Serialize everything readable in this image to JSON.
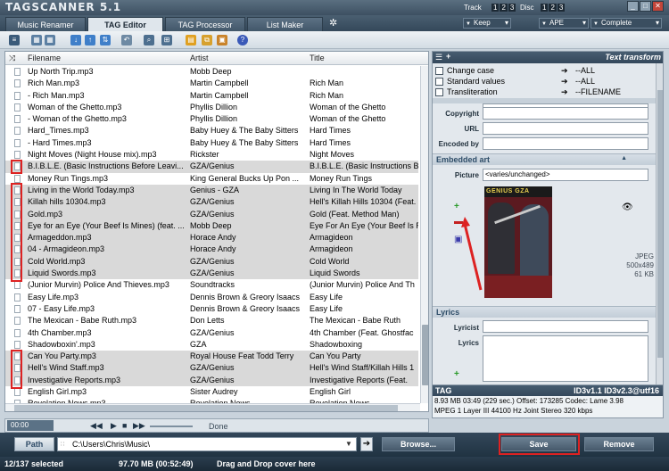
{
  "app": {
    "logo": "TAGSCANNER 5.1"
  },
  "top": {
    "track_label": "Track",
    "track_nums": [
      "1",
      "2",
      "3"
    ],
    "disc_label": "Disc",
    "disc_nums": [
      "1",
      "2",
      "3"
    ],
    "keep": "Keep",
    "ape": "APE",
    "complete": "Complete"
  },
  "tabs": [
    "Music Renamer",
    "TAG Editor",
    "TAG Processor",
    "List Maker"
  ],
  "active_tab": 1,
  "list": {
    "headers": [
      "Filename",
      "Artist",
      "Title"
    ],
    "rows": [
      [
        "Up North Trip.mp3",
        "Mobb Deep",
        ""
      ],
      [
        "Rich Man.mp3",
        "Martin Campbell",
        "Rich Man"
      ],
      [
        "- Rich Man.mp3",
        "Martin Campbell",
        "Rich Man"
      ],
      [
        "Woman of the Ghetto.mp3",
        "Phyllis Dillion",
        "Woman of the Ghetto"
      ],
      [
        "- Woman of the Ghetto.mp3",
        "Phyllis Dillion",
        "Woman of the Ghetto"
      ],
      [
        "Hard_Times.mp3",
        "Baby Huey & The Baby Sitters",
        "Hard Times"
      ],
      [
        "- Hard Times.mp3",
        "Baby Huey & The Baby Sitters",
        "Hard Times"
      ],
      [
        "Night Moves (Night House mix).mp3",
        "Rickster",
        "Night Moves"
      ],
      [
        "B.I.B.L.E. (Basic Instructions Before Leavi...",
        "GZA/Genius",
        "B.I.B.L.E. (Basic Instructions Be"
      ],
      [
        "Money Run Tings.mp3",
        "King General Bucks Up Pon ...",
        "Money Run Tings"
      ],
      [
        "Living in the World Today.mp3",
        "Genius - GZA",
        "Living In The World Today"
      ],
      [
        "Killah hills 10304.mp3",
        "GZA/Genius",
        "Hell's Killah Hills 10304 (Feat."
      ],
      [
        "Gold.mp3",
        "GZA/Genius",
        "Gold (Feat. Method Man)"
      ],
      [
        "Eye for an Eye (Your Beef Is Mines) (feat. ...",
        "Mobb Deep",
        "Eye For An Eye (Your Beef Is Ra"
      ],
      [
        "Armageddon.mp3",
        "Horace Andy",
        "Armagideon"
      ],
      [
        "04 - Armagideon.mp3",
        "Horace Andy",
        "Armagideon"
      ],
      [
        "Cold World.mp3",
        "GZA/Genius",
        "Cold World"
      ],
      [
        "Liquid Swords.mp3",
        "GZA/Genius",
        "Liquid Swords"
      ],
      [
        "(Junior Murvin) Police And Thieves.mp3",
        "Soundtracks",
        "(Junior Murvin) Police And Th"
      ],
      [
        "Easy Life.mp3",
        "Dennis Brown & Greory Isaacs",
        "Easy Life"
      ],
      [
        "07 - Easy Life.mp3",
        "Dennis Brown & Greory Isaacs",
        "Easy Life"
      ],
      [
        "The Mexican - Babe Ruth.mp3",
        "Don Letts",
        "The Mexican - Babe Ruth"
      ],
      [
        "4th Chamber.mp3",
        "GZA/Genius",
        "4th Chamber (Feat. Ghostfac"
      ],
      [
        "Shadowboxin'.mp3",
        "GZA",
        "Shadowboxing"
      ],
      [
        "Can You Party.mp3",
        "Royal House Feat Todd Terry",
        "Can You Party"
      ],
      [
        "Hell's Wind Staff.mp3",
        "GZA/Genius",
        "Hell's Wind Staff/Killah Hills 1"
      ],
      [
        "Investigative Reports.mp3",
        "GZA/Genius",
        "Investigative Reports (Feat."
      ],
      [
        "English Girl.mp3",
        "Sister Audrey",
        "English Girl"
      ],
      [
        "Revelation News.mp3",
        "Revelation News",
        "Revelation News"
      ]
    ],
    "selected": [
      8,
      10,
      11,
      12,
      13,
      14,
      15,
      16,
      17,
      24,
      25,
      26
    ]
  },
  "player": {
    "time": "00:00",
    "status": "Done"
  },
  "transform": {
    "title": "Text transform",
    "items": [
      {
        "label": "Change case",
        "value": "--ALL"
      },
      {
        "label": "Standard values",
        "value": "--ALL"
      },
      {
        "label": "Transliteration",
        "value": "--FILENAME"
      }
    ]
  },
  "fields": {
    "copyright": "Copyright",
    "url": "URL",
    "encoded_by": "Encoded by"
  },
  "art": {
    "section": "Embedded art",
    "picture_label": "Picture",
    "picture_value": "<varies/unchanged>",
    "cover_text": "GENIUS GZA",
    "format": "JPEG",
    "dims": "500x489",
    "size": "61 KB"
  },
  "lyrics": {
    "section": "Lyrics",
    "lyricist": "Lyricist",
    "lyrics": "Lyrics"
  },
  "tag": {
    "label": "TAG",
    "versions": "ID3v1.1   ID3v2.3@utf16",
    "line1": "8.93 MB 03:49 (229 sec.)  Offset: 173285  Codec: Lame 3.98",
    "line2": "MPEG 1 Layer III  44100 Hz  Joint Stereo  320 kbps"
  },
  "path": {
    "label": "Path",
    "value": "C:\\Users\\Chris\\Music\\",
    "browse": "Browse...",
    "save": "Save",
    "remove": "Remove"
  },
  "status": {
    "selected": "12/137 selected",
    "size": "97.70 MB (00:52:49)",
    "hint": "Drag and Drop cover here"
  }
}
